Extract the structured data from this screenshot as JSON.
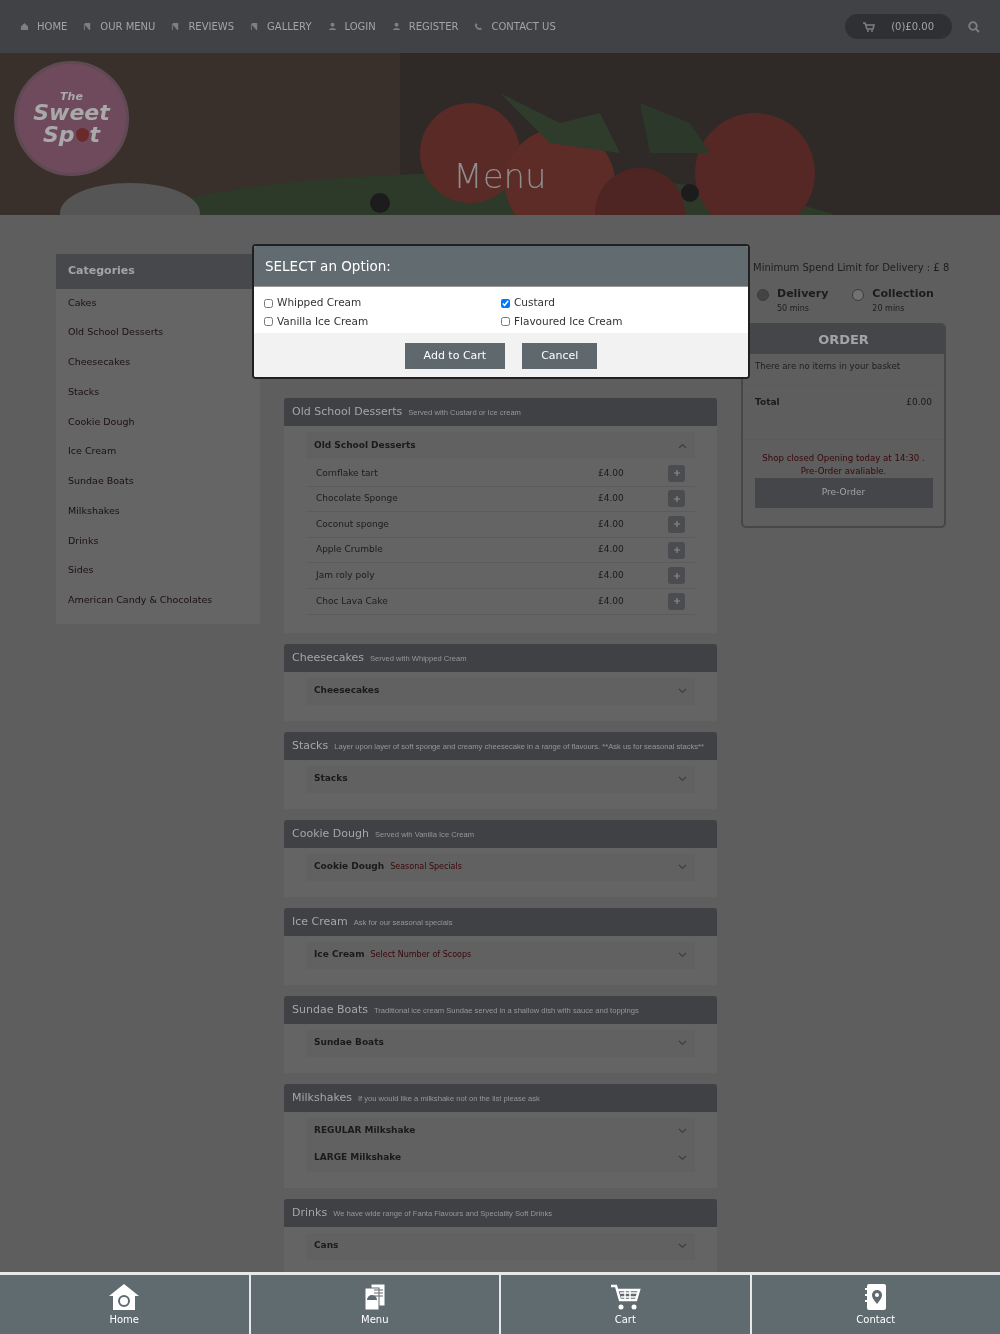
{
  "nav": {
    "items": [
      {
        "label": "HOME",
        "kind": "home"
      },
      {
        "label": "OUR MENU",
        "kind": "book"
      },
      {
        "label": "REVIEWS",
        "kind": "book"
      },
      {
        "label": "GALLERY",
        "kind": "book"
      },
      {
        "label": "LOGIN",
        "kind": "user"
      },
      {
        "label": "REGISTER",
        "kind": "user"
      },
      {
        "label": "CONTACT US",
        "kind": "phone"
      }
    ],
    "cart": "(0)£0.00"
  },
  "logo": {
    "lines": [
      "The",
      "Sweet",
      "Sp",
      "t"
    ]
  },
  "hero": {
    "title": "Menu"
  },
  "categories": {
    "title": "Categories",
    "items": [
      "Cakes",
      "Old School Desserts",
      "Cheesecakes",
      "Stacks",
      "Cookie Dough",
      "Ice Cream",
      "Sundae Boats",
      "Milkshakes",
      "Drinks",
      "Sides",
      "American Candy & Chocolates"
    ]
  },
  "modal": {
    "title": "SELECT an Option:",
    "options": [
      {
        "label": "Whipped Cream",
        "checked": false
      },
      {
        "label": "Custard",
        "checked": true
      },
      {
        "label": "Vanilla Ice Cream",
        "checked": false
      },
      {
        "label": "Flavoured Ice Cream",
        "checked": false
      }
    ],
    "buttons": [
      "Add to Cart",
      "Cancel"
    ]
  },
  "sections": [
    {
      "title": "Old School Desserts",
      "subtitle": "Served with Custard or Ice cream",
      "groups": [
        {
          "title": "Old School Desserts",
          "expanded": true,
          "items": [
            {
              "name": "Cornflake tart",
              "price": "£4.00"
            },
            {
              "name": "Chocolate Sponge",
              "price": "£4.00"
            },
            {
              "name": "Coconut sponge",
              "price": "£4.00"
            },
            {
              "name": "Apple Crumble",
              "price": "£4.00"
            },
            {
              "name": "Jam roly poly",
              "price": "£4.00"
            },
            {
              "name": "Choc Lava Cake",
              "price": "£4.00"
            }
          ]
        }
      ]
    },
    {
      "title": "Cheesecakes",
      "subtitle": "Served with Whipped Cream",
      "groups": [
        {
          "title": "Cheesecakes",
          "expanded": false
        }
      ]
    },
    {
      "title": "Stacks",
      "subtitle": "Layer upon layer of soft sponge and creamy cheesecake in a range of flavours. **Ask us for seasonal stacks**",
      "groups": [
        {
          "title": "Stacks",
          "expanded": false
        }
      ]
    },
    {
      "title": "Cookie Dough",
      "subtitle": "Served wih Vanilla Ice Cream",
      "groups": [
        {
          "title": "Cookie Dough",
          "tag": "Seasonal Specials",
          "expanded": false
        }
      ]
    },
    {
      "title": "Ice Cream",
      "subtitle": "Ask for our seasonal specials",
      "groups": [
        {
          "title": "Ice Cream",
          "tag": "Select Number of Scoops",
          "expanded": false
        }
      ]
    },
    {
      "title": "Sundae Boats",
      "subtitle": "Traditional ice cream Sundae served in a shallow dish with sauce and toppings",
      "groups": [
        {
          "title": "Sundae Boats",
          "expanded": false
        }
      ]
    },
    {
      "title": "Milkshakes",
      "subtitle": "If you would like a milkshake not on the list please ask",
      "groups": [
        {
          "title": "REGULAR Milkshake",
          "expanded": false
        },
        {
          "title": "LARGE Milkshake",
          "expanded": false
        }
      ]
    },
    {
      "title": "Drinks",
      "subtitle": "We have wide range of Fanta Flavours and Speciality Soft Drinks",
      "groups": [
        {
          "title": "Cans",
          "expanded": false
        }
      ]
    }
  ],
  "delivery": {
    "min_spend": "Minimum Spend Limit for Delivery : £ 8",
    "options": [
      {
        "label": "Delivery",
        "time": "50 mins",
        "selected": true
      },
      {
        "label": "Collection",
        "time": "20 mins",
        "selected": false
      }
    ]
  },
  "order": {
    "title": "ORDER",
    "empty": "There are no items in your basket",
    "total_label": "Total",
    "total": "£0.00",
    "notice": [
      "Shop closed Opening today at 14:30 .",
      "Pre-Order avaliable."
    ],
    "button": "Pre-Order"
  },
  "bottom_bar": [
    {
      "label": "Home",
      "kind": "home"
    },
    {
      "label": "Menu",
      "kind": "menu"
    },
    {
      "label": "Cart",
      "kind": "cart"
    },
    {
      "label": "Contact",
      "kind": "contact"
    }
  ]
}
